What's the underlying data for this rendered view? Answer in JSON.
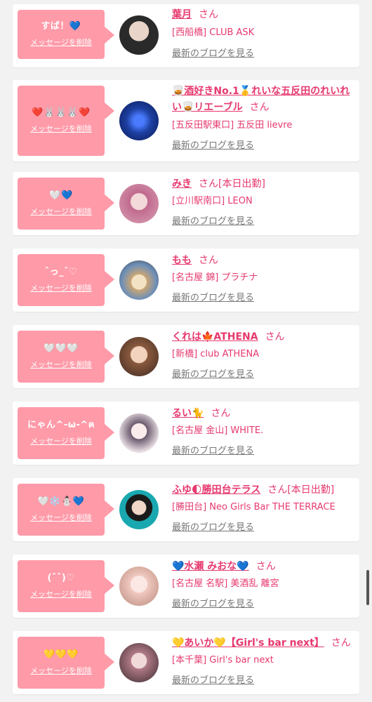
{
  "common": {
    "delete_label": "メッセージを削除",
    "blog_label": "最新のブログを見る",
    "san": "さん"
  },
  "items": [
    {
      "message": "すば！💙",
      "name": "葉月",
      "tag": "",
      "shop": "[西船橋] CLUB ASK",
      "avatar_color": "#2a2a2a"
    },
    {
      "message": "❤️🐰🐰🐰❤️",
      "name": "🥃酒好きNo.1🥇れいな五反田のれいれい🥃リエーブル",
      "tag": "",
      "shop": "[五反田駅東口] 五反田 lievre",
      "avatar_color": "#1d3fa0"
    },
    {
      "message": "🤍💙",
      "name": "みき",
      "tag": "[本日出勤]",
      "shop": "[立川駅南口] LEON",
      "avatar_color": "#d9a0b4"
    },
    {
      "message": "ˆ⁠っ⁠_⁠ˆ⁠♡",
      "name": "もも",
      "tag": "",
      "shop": "[名古屋 錦] プラチナ",
      "avatar_color": "#c9a574"
    },
    {
      "message": "🤍🤍🤍",
      "name": "くれは🍁ATHENA",
      "tag": "",
      "shop": "[新橋] club ATHENA",
      "avatar_color": "#8a5a3e"
    },
    {
      "message": "にゃん^-ω-^ฅ",
      "name": "るい🐈",
      "tag": "",
      "shop": "[名古屋 金山] WHITE.",
      "avatar_color": "#e7dde2"
    },
    {
      "message": "🤍❄️⛄💙",
      "name": "ふゆ🌓勝田台テラス",
      "tag": "[本日出勤]",
      "shop": "[勝田台] Neo Girls Bar THE TERRACE",
      "avatar_color": "#1aa8b0"
    },
    {
      "message": "(ˆˆ)♡",
      "name": "💙水瀬 みおな💙",
      "tag": "",
      "shop": "[名古屋 名駅] 美酒乱 離宮",
      "avatar_color": "#f0c9c0"
    },
    {
      "message": "💛💛💛",
      "name": "💛あいか💛【Girl's bar next】",
      "tag": "",
      "shop": "[本千葉] Girl's bar next",
      "avatar_color": "#b07a86"
    }
  ]
}
